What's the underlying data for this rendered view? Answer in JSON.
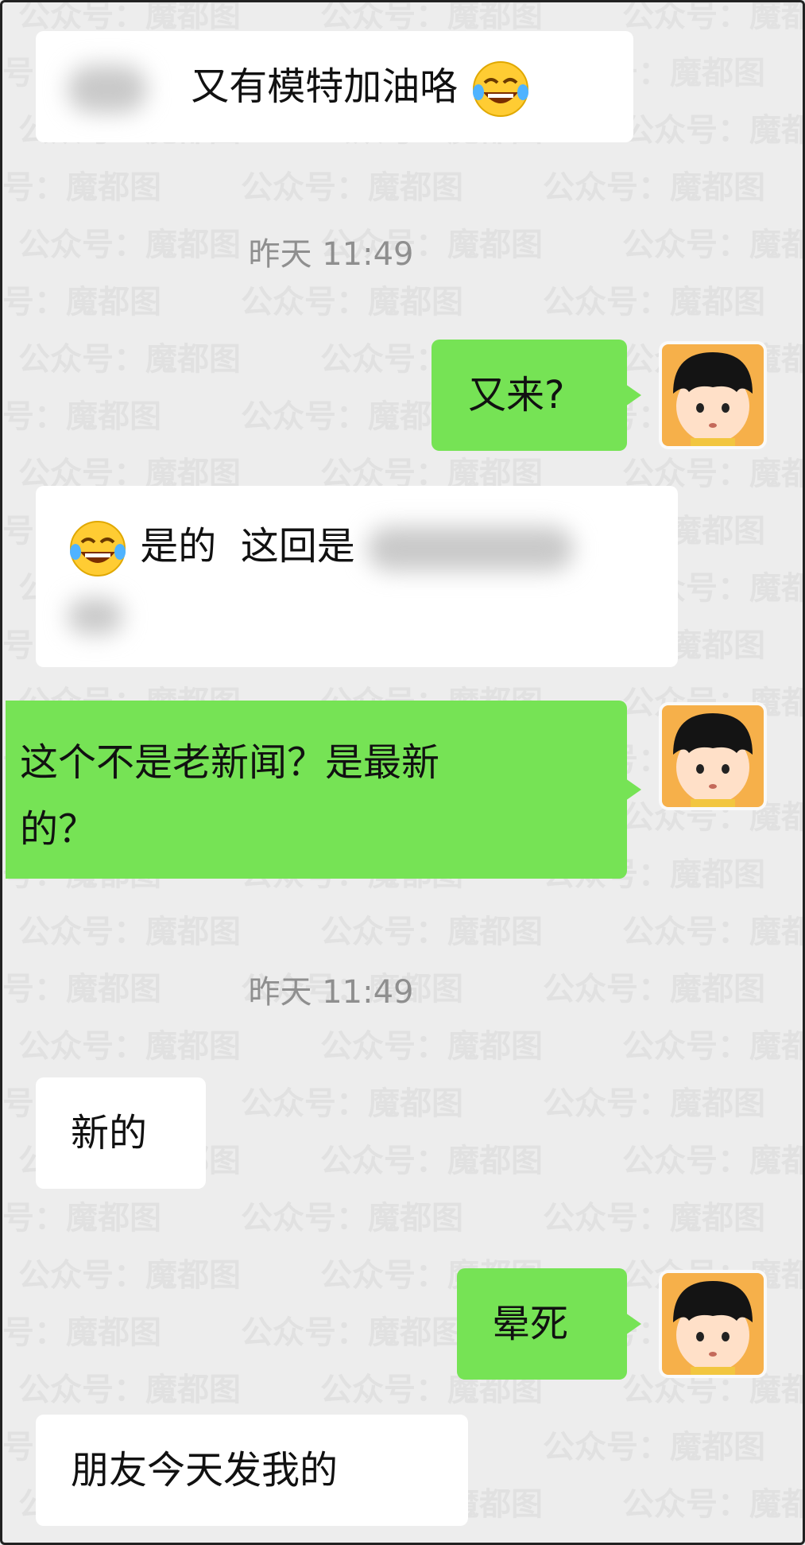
{
  "watermark": {
    "text": "公众号：魔都图"
  },
  "colors": {
    "background": "#ededed",
    "incoming": "#ffffff",
    "outgoing": "#76e355",
    "timestamp": "#8f8f8f"
  },
  "messages": [
    {
      "side": "in",
      "text": "又有模特加油咯",
      "emoji": "tears-of-joy-icon"
    },
    {
      "timestamp": "昨天 11:49"
    },
    {
      "side": "out",
      "text": "又来?"
    },
    {
      "side": "in",
      "emoji": "tears-of-joy-icon",
      "text": "是的  这回是"
    },
    {
      "side": "out",
      "text": "这个不是老新闻？是最新的？"
    },
    {
      "timestamp": "昨天 11:49"
    },
    {
      "side": "in",
      "text": "新的"
    },
    {
      "side": "out",
      "text": "晕死"
    },
    {
      "side": "in",
      "text": "朋友今天发我的"
    }
  ],
  "ui": {
    "m1_text": "又有模特加油咯",
    "ts1": "昨天 11:49",
    "m2_text": "又来?",
    "m3_text": "是的  这回是",
    "m4_line1": "这个不是老新闻？是最新",
    "m4_line2": "的？",
    "ts2": "昨天 11:49",
    "m5_text": "新的",
    "m6_text": "晕死",
    "m7_text": "朋友今天发我的"
  }
}
